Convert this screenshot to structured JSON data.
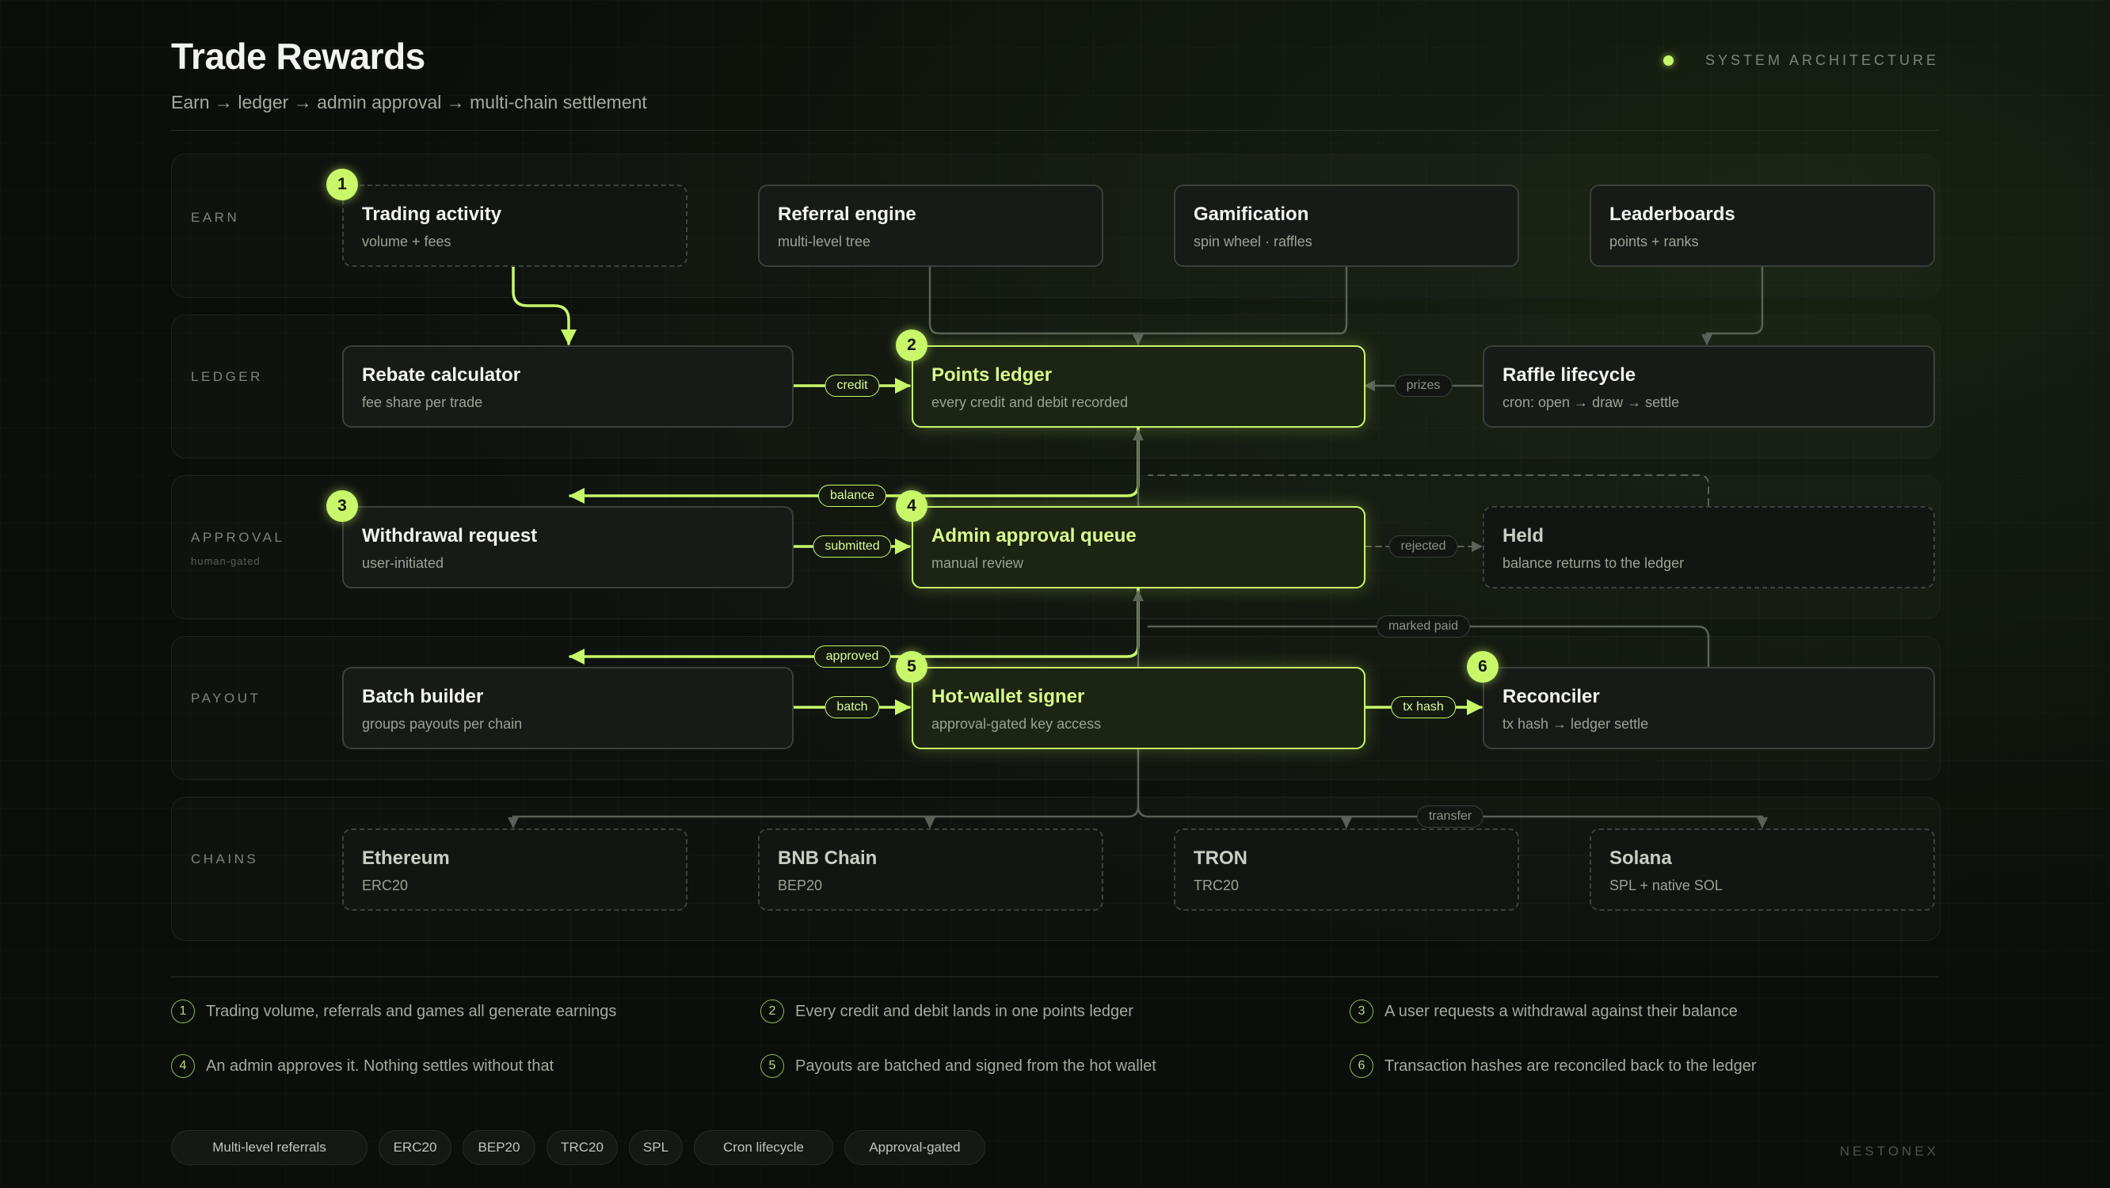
{
  "header": {
    "title": "Trade Rewards",
    "subtitle": "Earn → ledger → admin approval → multi-chain settlement",
    "tag": "SYSTEM ARCHITECTURE"
  },
  "lanes": {
    "earn": "EARN",
    "ledger": "LEDGER",
    "approval": "APPROVAL",
    "approval_sub": "human-gated",
    "payout": "PAYOUT",
    "chains": "CHAINS"
  },
  "nodes": {
    "trading": {
      "title": "Trading activity",
      "sub": "volume + fees"
    },
    "referral": {
      "title": "Referral engine",
      "sub": "multi-level tree"
    },
    "gamification": {
      "title": "Gamification",
      "sub": "spin wheel · raffles"
    },
    "leaderboards": {
      "title": "Leaderboards",
      "sub": "points + ranks"
    },
    "rebate": {
      "title": "Rebate calculator",
      "sub": "fee share per trade"
    },
    "points": {
      "title": "Points ledger",
      "sub": "every credit and debit recorded"
    },
    "raffle": {
      "title": "Raffle lifecycle",
      "sub": "cron: open → draw → settle"
    },
    "withdrawal": {
      "title": "Withdrawal request",
      "sub": "user-initiated"
    },
    "admin": {
      "title": "Admin approval queue",
      "sub": "manual review"
    },
    "held": {
      "title": "Held",
      "sub": "balance returns to the ledger"
    },
    "batch": {
      "title": "Batch builder",
      "sub": "groups payouts per chain"
    },
    "signer": {
      "title": "Hot-wallet signer",
      "sub": "approval-gated key access"
    },
    "reconciler": {
      "title": "Reconciler",
      "sub": "tx hash → ledger settle"
    },
    "ethereum": {
      "title": "Ethereum",
      "sub": "ERC20"
    },
    "bnb": {
      "title": "BNB Chain",
      "sub": "BEP20"
    },
    "tron": {
      "title": "TRON",
      "sub": "TRC20"
    },
    "solana": {
      "title": "Solana",
      "sub": "SPL + native SOL"
    }
  },
  "badges": [
    "1",
    "2",
    "3",
    "4",
    "5",
    "6"
  ],
  "edge_labels": {
    "credit": "credit",
    "prizes": "prizes",
    "balance": "balance",
    "submitted": "submitted",
    "rejected": "rejected",
    "marked_paid": "marked paid",
    "approved": "approved",
    "batch": "batch",
    "tx_hash": "tx hash",
    "transfer": "transfer"
  },
  "legend": [
    {
      "num": "1",
      "text": "Trading volume, referrals and games all generate earnings"
    },
    {
      "num": "2",
      "text": "Every credit and debit lands in one points ledger"
    },
    {
      "num": "3",
      "text": "A user requests a withdrawal against their balance"
    },
    {
      "num": "4",
      "text": "An admin approves it. Nothing settles without that"
    },
    {
      "num": "5",
      "text": "Payouts are batched and signed from the hot wallet"
    },
    {
      "num": "6",
      "text": "Transaction hashes are reconciled back to the ledger"
    }
  ],
  "tags": [
    "Multi-level referrals",
    "ERC20",
    "BEP20",
    "TRC20",
    "SPL",
    "Cron lifecycle",
    "Approval-gated"
  ],
  "brand": "NESTONEX",
  "colors": {
    "accent": "#c8f76a",
    "background": "#0b0f0b",
    "muted_edge": "#5a6158"
  }
}
